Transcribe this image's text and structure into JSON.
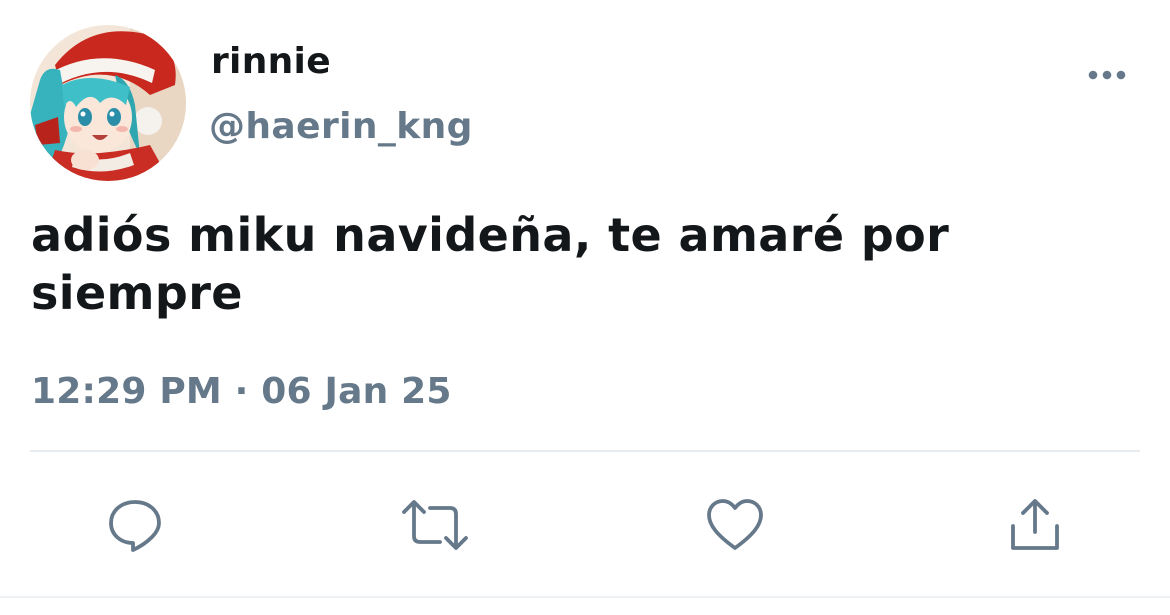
{
  "tweet": {
    "display_name": "rinnie",
    "handle": "@haerin_kng",
    "text": "adiós miku navideña, te amaré por siempre",
    "time": "12:29 PM",
    "separator": " · ",
    "date": "06 Jan 25"
  },
  "icons": {
    "more": "more-horizontal-icon",
    "reply": "comment-icon",
    "retweet": "retweet-icon",
    "like": "heart-icon",
    "share": "share-icon"
  },
  "colors": {
    "primary_text": "#14171a",
    "secondary_text": "#66798a",
    "icon": "#66798a",
    "divider": "#e6ecf0",
    "background": "#ffffff"
  }
}
